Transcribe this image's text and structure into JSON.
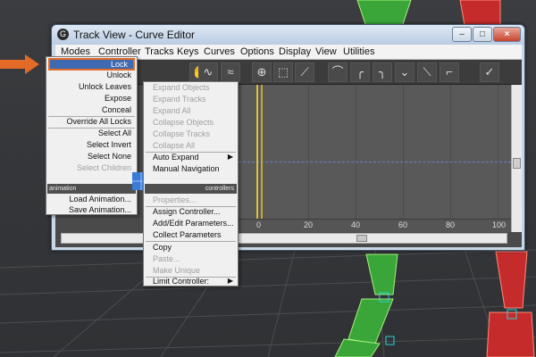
{
  "window": {
    "title": "Track View - Curve Editor",
    "minimize_label": "–",
    "restore_label": "□",
    "close_label": "×"
  },
  "menubar": {
    "items": [
      "Modes",
      "Controller",
      "Tracks",
      "Keys",
      "Curves",
      "Options",
      "Display",
      "View",
      "Utilities"
    ]
  },
  "toolbar": {
    "icons": [
      "hand-icon",
      "curve-icon",
      "curve-icon",
      "zoom-icon",
      "region-select-icon",
      "snap-icon",
      "tangent-icon"
    ]
  },
  "ruler": {
    "ticks": [
      "0",
      "20",
      "40",
      "60",
      "80",
      "100"
    ]
  },
  "left_menu": {
    "items": [
      {
        "label": "Lock",
        "state": "highlighted"
      },
      {
        "label": "Unlock",
        "state": "enabled"
      },
      {
        "label": "Unlock Leaves",
        "state": "enabled"
      },
      {
        "label": "Expose",
        "state": "enabled"
      },
      {
        "label": "Conceal",
        "state": "enabled"
      },
      {
        "label": "Override All Locks",
        "state": "enabled"
      },
      {
        "label": "Select All",
        "state": "enabled"
      },
      {
        "label": "Select Invert",
        "state": "enabled"
      },
      {
        "label": "Select None",
        "state": "enabled"
      },
      {
        "label": "Select Children",
        "state": "disabled"
      },
      {
        "label": "animation",
        "state": "section"
      },
      {
        "label": "Load Animation...",
        "state": "enabled"
      },
      {
        "label": "Save Animation...",
        "state": "enabled"
      }
    ]
  },
  "right_menu": {
    "items": [
      {
        "label": "Expand Objects",
        "state": "disabled"
      },
      {
        "label": "Expand Tracks",
        "state": "disabled"
      },
      {
        "label": "Expand All",
        "state": "disabled"
      },
      {
        "label": "Collapse Objects",
        "state": "disabled"
      },
      {
        "label": "Collapse Tracks",
        "state": "disabled"
      },
      {
        "label": "Collapse All",
        "state": "disabled"
      },
      {
        "label": "Auto Expand",
        "state": "enabled"
      },
      {
        "label": "Manual Navigation",
        "state": "enabled"
      },
      {
        "label": "controllers",
        "state": "section"
      },
      {
        "label": "Properties...",
        "state": "disabled"
      },
      {
        "label": "Assign Controller...",
        "state": "enabled"
      },
      {
        "label": "Add/Edit Parameters...",
        "state": "enabled"
      },
      {
        "label": "Collect Parameters",
        "state": "enabled"
      },
      {
        "label": "Copy",
        "state": "enabled"
      },
      {
        "label": "Paste...",
        "state": "disabled"
      },
      {
        "label": "Make Unique",
        "state": "disabled"
      },
      {
        "label": "Limit Controller:",
        "state": "enabled"
      }
    ]
  },
  "colors": {
    "highlight": "#3d6ab0",
    "callout_orange": "#e46b27",
    "cursor_yellow": "#e0c135",
    "character_green": "#3aa63a",
    "character_red": "#c62b2b"
  }
}
